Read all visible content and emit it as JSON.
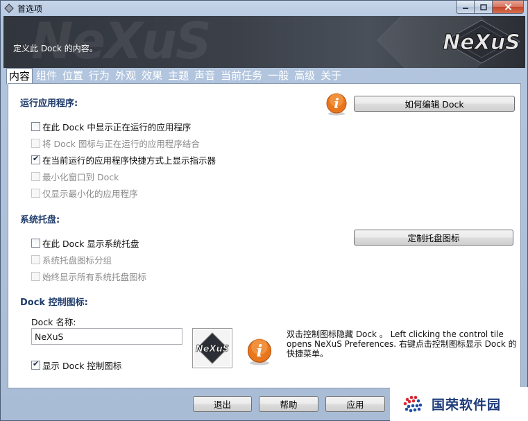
{
  "window": {
    "title": "首选项"
  },
  "banner": {
    "description": "定义此 Dock 的内容。",
    "logo_text": "NeXuS",
    "watermark_text": "NeXuS"
  },
  "tabs": [
    {
      "label": "内容",
      "active": true
    },
    {
      "label": "组件"
    },
    {
      "label": "位置"
    },
    {
      "label": "行为"
    },
    {
      "label": "外观"
    },
    {
      "label": "效果"
    },
    {
      "label": "主题"
    },
    {
      "label": "声音"
    },
    {
      "label": "当前任务"
    },
    {
      "label": "一般"
    },
    {
      "label": "高级"
    },
    {
      "label": "关于"
    }
  ],
  "running_apps": {
    "title": "运行应用程序:",
    "edit_button": "如何编辑 Dock",
    "options": [
      {
        "label": "在此 Dock 中显示正在运行的应用程序",
        "checked": false,
        "enabled": true
      },
      {
        "label": "将 Dock 图标与正在运行的应用程序结合",
        "checked": false,
        "enabled": false
      },
      {
        "label": "在当前运行的应用程序快捷方式上显示指示器",
        "checked": true,
        "enabled": true
      },
      {
        "label": "最小化窗口到 Dock",
        "checked": false,
        "enabled": false
      },
      {
        "label": "仅显示最小化的应用程序",
        "checked": false,
        "enabled": false
      }
    ]
  },
  "system_tray": {
    "title": "系统托盘:",
    "customize_button": "定制托盘图标",
    "options": [
      {
        "label": "在此 Dock 显示系统托盘",
        "checked": false,
        "enabled": true
      },
      {
        "label": "系统托盘图标分组",
        "checked": false,
        "enabled": false
      },
      {
        "label": "始终显示所有系统托盘图标",
        "checked": false,
        "enabled": false
      }
    ]
  },
  "dock_control": {
    "title": "Dock 控制图标:",
    "name_label": "Dock 名称:",
    "name_value": "NeXuS",
    "show_label": "显示 Dock 控制图标",
    "show_checked": true,
    "logo_text": "NeXuS",
    "description_lines": [
      "双击控制图标隐藏 Dock 。 Left clicking the control tile",
      "opens NeXuS Preferences. 右键点击控制图标显示 Dock 的",
      "快捷菜单。"
    ]
  },
  "footer": {
    "exit_button": "退出",
    "help_button": "帮助",
    "apply_button": "应用"
  },
  "watermark": {
    "text": "国荣软件园"
  },
  "colors": {
    "section_title": "#1e3b6b",
    "info_orange": "#e8761c",
    "banner_bg": "#3b4049"
  }
}
